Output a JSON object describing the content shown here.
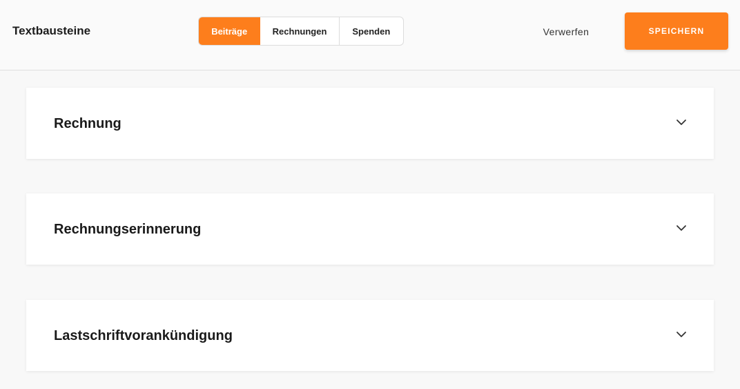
{
  "header": {
    "title": "Textbausteine",
    "tabs": [
      {
        "label": "Beiträge",
        "active": true
      },
      {
        "label": "Rechnungen",
        "active": false
      },
      {
        "label": "Spenden",
        "active": false
      }
    ],
    "discard_label": "Verwerfen",
    "save_label": "SPEICHERN"
  },
  "panels": [
    {
      "title": "Rechnung",
      "icon": "chevron-down-icon"
    },
    {
      "title": "Rechnungserinnerung",
      "icon": "chevron-down-icon"
    },
    {
      "title": "Lastschriftvorankündigung",
      "icon": "chevron-down-icon"
    }
  ],
  "colors": {
    "accent": "#fd7e1c",
    "background": "#f8f8f8",
    "panel": "#ffffff"
  }
}
